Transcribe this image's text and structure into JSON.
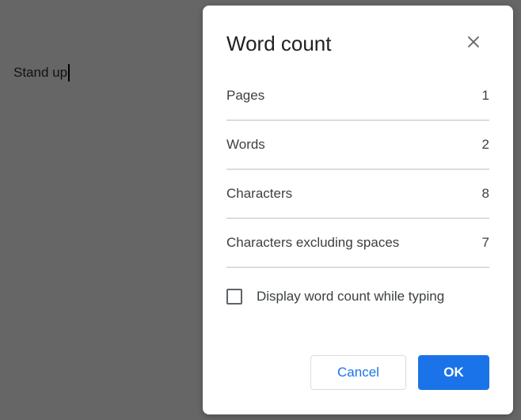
{
  "document": {
    "text": "Stand up"
  },
  "dialog": {
    "title": "Word count",
    "close_icon": "close-icon",
    "stats": [
      {
        "label": "Pages",
        "value": "1"
      },
      {
        "label": "Words",
        "value": "2"
      },
      {
        "label": "Characters",
        "value": "8"
      },
      {
        "label": "Characters excluding spaces",
        "value": "7"
      }
    ],
    "checkbox_label": "Display word count while typing",
    "checkbox_checked": false,
    "cancel_label": "Cancel",
    "ok_label": "OK"
  },
  "colors": {
    "overlay": "#666666",
    "primary": "#1a73e8",
    "divider": "#dadce0",
    "text": "#3c4043"
  }
}
